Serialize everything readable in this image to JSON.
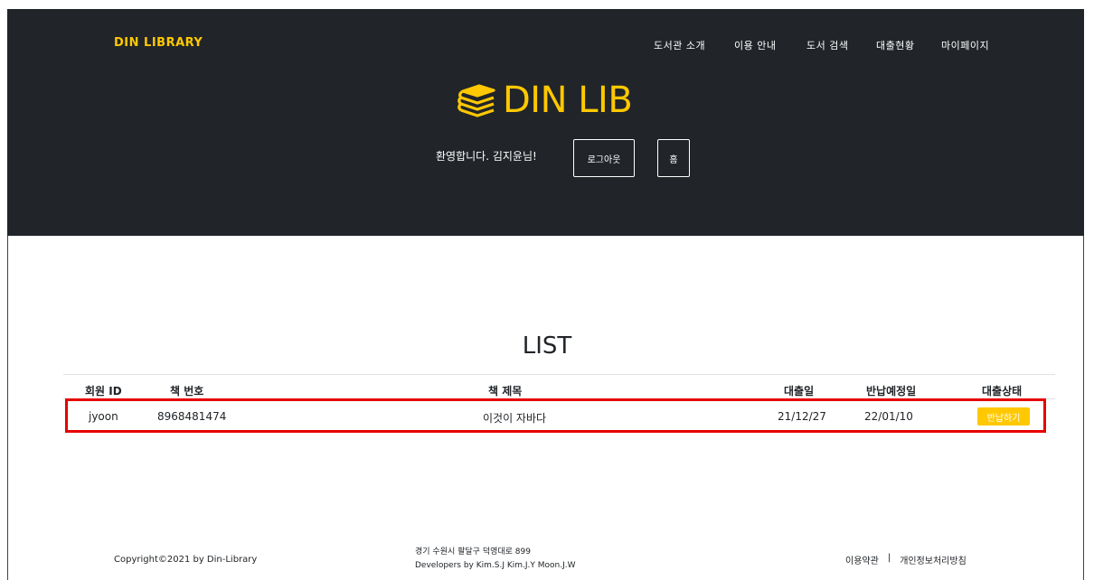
{
  "header": {
    "brand": "DIN LIBRARY",
    "nav": [
      "도서관 소개",
      "이용 안내",
      "도서 검색",
      "대출현황",
      "마이페이지"
    ],
    "logo_text": "DIN LIB",
    "welcome": "환영합니다. 김지윤님!",
    "logout_label": "로그아웃",
    "home_label": "홈",
    "colors": {
      "background": "#212529",
      "accent": "#ffc800"
    }
  },
  "main": {
    "title": "LIST",
    "columns": [
      "회원 ID",
      "책 번호",
      "책 제목",
      "대출일",
      "반납예정일",
      "대출상태"
    ],
    "rows": [
      {
        "member_id": "jyoon",
        "book_no": "8968481474",
        "book_title": "이것이 자바다",
        "loan_date": "21/12/27",
        "due_date": "22/01/10",
        "status_button": "반납하기"
      }
    ],
    "highlight_color": "#e60000"
  },
  "footer": {
    "copyright": "Copyright©2021 by Din-Library",
    "address": "경기 수원시 팔달구 덕영대로 899",
    "developers": "Developers by Kim.S.J Kim.J.Y Moon.J.W",
    "terms": "이용약관",
    "separator": "|",
    "privacy": "개인정보처리방침"
  }
}
